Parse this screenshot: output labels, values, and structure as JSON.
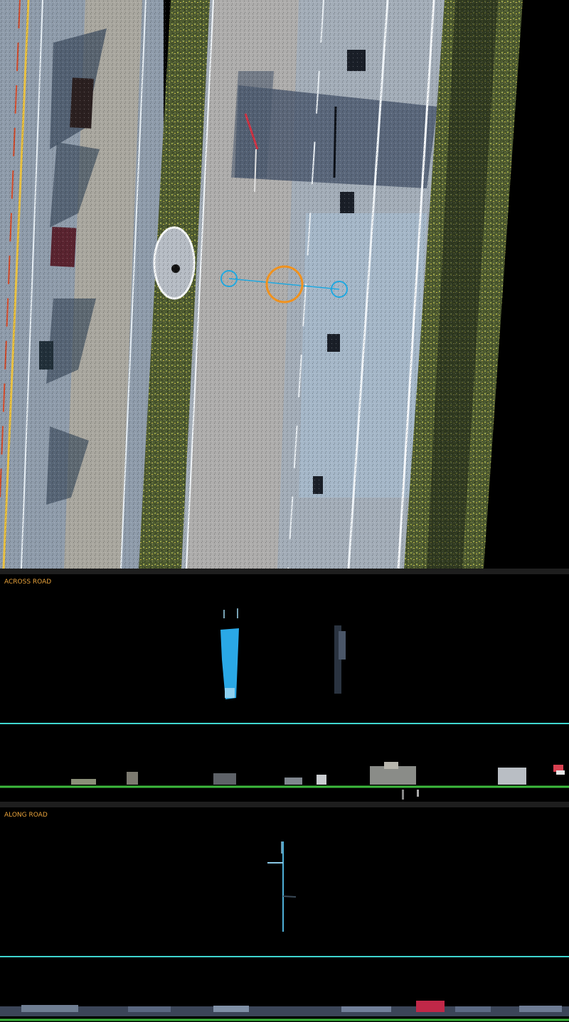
{
  "views": {
    "aerial": {
      "name": "top-down point cloud"
    },
    "across_road": {
      "label": "ACROSS ROAD"
    },
    "along_road": {
      "label": "ALONG ROAD"
    }
  },
  "colors": {
    "label": "#e8a23a",
    "marker_cyan": "#1fa8e0",
    "marker_orange": "#f0921e",
    "guide_line": "#3fd6d0",
    "ground_line": "#3dbb3d"
  }
}
